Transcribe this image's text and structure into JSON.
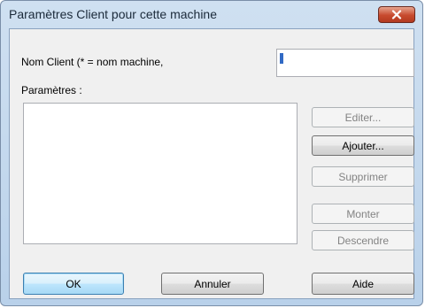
{
  "window": {
    "title": "Paramètres Client pour cette machine"
  },
  "form": {
    "client_name_label": "Nom Client (* = nom machine,",
    "client_name_value": "",
    "params_label": "Paramètres :",
    "params_items": []
  },
  "side_buttons": {
    "edit": "Editer...",
    "add": "Ajouter...",
    "delete": "Supprimer",
    "up": "Monter",
    "down": "Descendre"
  },
  "bottom_buttons": {
    "ok": "OK",
    "cancel": "Annuler",
    "help": "Aide"
  },
  "icons": {
    "close": "close-x-icon"
  },
  "colors": {
    "close_button": "#c74a2e",
    "frame": "#b9d1ea",
    "selection": "#316ac5"
  }
}
